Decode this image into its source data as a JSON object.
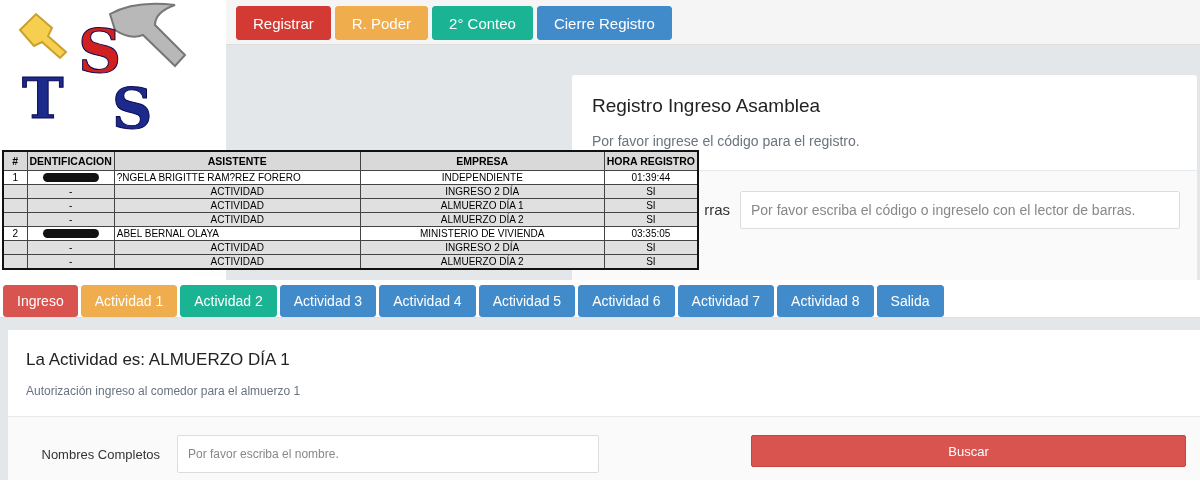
{
  "logo": {
    "letters": [
      "S",
      "T",
      "S"
    ]
  },
  "toolbar": [
    {
      "label": "Registrar",
      "color": "#d33a34"
    },
    {
      "label": "R. Poder",
      "color": "#f0ad4e"
    },
    {
      "label": "2° Conteo",
      "color": "#1ab394"
    },
    {
      "label": "Cierre Registro",
      "color": "#428bca"
    }
  ],
  "registro": {
    "title": "Registro Ingreso Asamblea",
    "subtitle": "Por favor ingrese el código para el registro.",
    "field_label": "rras",
    "placeholder": "Por favor escriba el código o ingreselo con el lector de barras."
  },
  "table": {
    "columns": [
      "#",
      "DENTIFICACION",
      "ASISTENTE",
      "EMPRESA",
      "HORA REGISTRO"
    ],
    "rows": [
      {
        "kind": "person",
        "number": "1",
        "asistente": "?NGELA BRIGITTE RAM?REZ FORERO",
        "empresa": "INDEPENDIENTE",
        "hora": "01:39:44"
      },
      {
        "kind": "activity",
        "identificacion": "-",
        "asistente": "ACTIVIDAD",
        "empresa": "INGRESO 2 DÍA",
        "hora": "SI"
      },
      {
        "kind": "activity",
        "identificacion": "-",
        "asistente": "ACTIVIDAD",
        "empresa": "ALMUERZO DÍA 1",
        "hora": "SI"
      },
      {
        "kind": "activity",
        "identificacion": "-",
        "asistente": "ACTIVIDAD",
        "empresa": "ALMUERZO DÍA 2",
        "hora": "SI"
      },
      {
        "kind": "person",
        "number": "2",
        "asistente": "ABEL BERNAL OLAYA",
        "empresa": "MINISTERIO DE VIVIENDA",
        "hora": "03:35:05"
      },
      {
        "kind": "activity",
        "identificacion": "-",
        "asistente": "ACTIVIDAD",
        "empresa": "INGRESO 2 DÍA",
        "hora": "SI"
      },
      {
        "kind": "activity",
        "identificacion": "-",
        "asistente": "ACTIVIDAD",
        "empresa": "ALMUERZO DÍA 2",
        "hora": "SI"
      }
    ]
  },
  "activity_tabs": [
    {
      "label": "Ingreso",
      "color": "#d9534f"
    },
    {
      "label": "Actividad 1",
      "color": "#f0ad4e"
    },
    {
      "label": "Actividad 2",
      "color": "#1ab394"
    },
    {
      "label": "Actividad 3",
      "color": "#428bca"
    },
    {
      "label": "Actividad 4",
      "color": "#428bca"
    },
    {
      "label": "Actividad 5",
      "color": "#428bca"
    },
    {
      "label": "Actividad 6",
      "color": "#428bca"
    },
    {
      "label": "Actividad 7",
      "color": "#428bca"
    },
    {
      "label": "Actividad 8",
      "color": "#428bca"
    },
    {
      "label": "Salida",
      "color": "#428bca"
    }
  ],
  "actividad": {
    "title": "La Actividad es: ALMUERZO DÍA 1",
    "subtitle": "Autorización ingreso al comedor para el almuerzo 1",
    "field_label": "Nombres Completos",
    "placeholder": "Por favor escriba el nombre.",
    "button": "Buscar"
  }
}
